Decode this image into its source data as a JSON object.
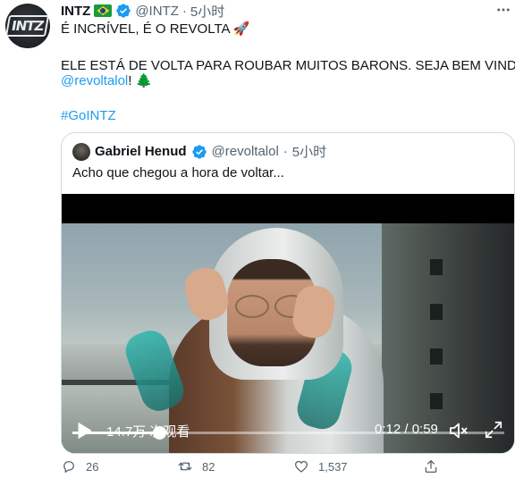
{
  "tweet": {
    "author_name": "INTZ",
    "avatar_text": "INTZ",
    "flag_emoji": "🇧🇷",
    "handle": "@INTZ",
    "dot": "·",
    "time": "5小时",
    "line1": "É INCRÍVEL, É O REVOLTA 🚀",
    "line2": "ELE ESTÁ DE VOLTA PARA ROUBAR MUITOS BARONS. SEJA BEM VINDO,",
    "mention": "@revoltalol",
    "line3_suffix": "! 🌲",
    "hashtag": "#GoINTZ"
  },
  "quoted": {
    "author_name": "Gabriel Henud",
    "handle": "@revoltalol",
    "dot": "·",
    "time": "5小时",
    "text": "Acho que chegou a hora de voltar..."
  },
  "video": {
    "views": "14.7万 次观看",
    "timer": "0:12 / 0:59",
    "progress": 0.2
  },
  "actions": {
    "reply_count": "26",
    "retweet_count": "82",
    "like_count": "1,537"
  },
  "colors": {
    "link": "#1d9bf0",
    "verified": "#1d9bf0",
    "muted_text": "#536471",
    "border": "#cfd9de"
  },
  "icons": [
    "verified-badge-icon",
    "more-icon",
    "play-icon",
    "mute-icon",
    "fullscreen-icon",
    "reply-icon",
    "retweet-icon",
    "like-icon",
    "share-icon"
  ]
}
